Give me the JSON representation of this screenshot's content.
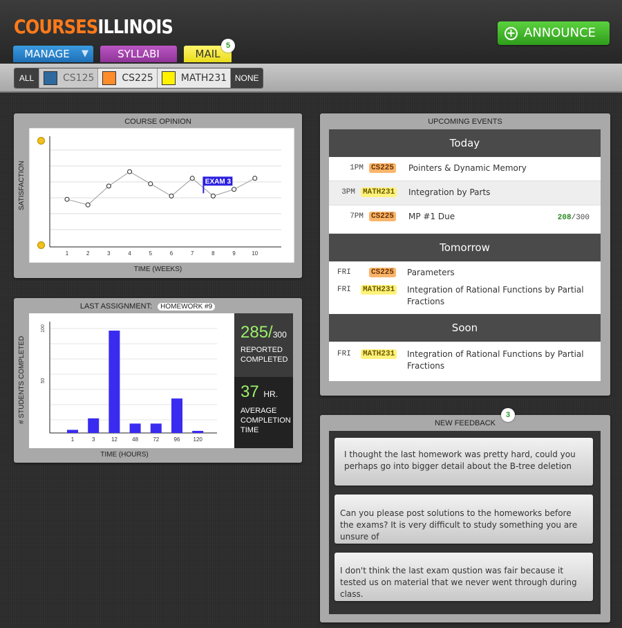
{
  "header": {
    "logo_part1": "COURSES",
    "logo_part2": "ILLINOIS",
    "tabs": {
      "manage": "MANAGE",
      "syllabi": "SYLLABI",
      "mail": "MAIL"
    },
    "mail_count": "5",
    "announce_label": "ANNOUNCE"
  },
  "filter": {
    "all": "ALL",
    "none": "NONE",
    "courses": [
      {
        "label": "CS125",
        "color": "#2e6a9e",
        "enabled": false
      },
      {
        "label": "CS225",
        "color": "#ff8c2a",
        "enabled": true
      },
      {
        "label": "MATH231",
        "color": "#fff200",
        "enabled": true
      }
    ]
  },
  "opinion": {
    "title": "COURSE OPINION",
    "ylabel": "SATISFACTION",
    "xlabel": "TIME (WEEKS)",
    "annotation": "EXAM 3"
  },
  "assignment": {
    "title": "LAST ASSIGNMENT:",
    "name": "HOMEWORK #9",
    "ylabel": "# STUDENTS  COMPLETED",
    "xlabel": "TIME (HOURS)",
    "reported_value": "285/",
    "reported_total": "300",
    "reported_label_1": "REPORTED",
    "reported_label_2": "COMPLETED",
    "avg_value": "37",
    "avg_unit": "HR.",
    "avg_label_1": "AVERAGE",
    "avg_label_2": "COMPLETION",
    "avg_label_3": "TIME"
  },
  "events": {
    "title": "UPCOMING EVENTS",
    "today": "Today",
    "tomorrow": "Tomorrow",
    "soon": "Soon",
    "today_items": [
      {
        "time": "1PM",
        "course": "CS225",
        "text": "Pointers & Dynamic Memory"
      },
      {
        "time": "3PM",
        "course": "MATH231",
        "text": "Integration by Parts"
      },
      {
        "time": "7PM",
        "course": "CS225",
        "text": "MP #1 Due",
        "score": "208",
        "score_total": "/300"
      }
    ],
    "tomorrow_items": [
      {
        "time": "FRI",
        "course": "CS225",
        "text": "Parameters"
      },
      {
        "time": "FRI",
        "course": "MATH231",
        "text": "Integration of Rational Functions by Partial Fractions"
      }
    ],
    "soon_items": [
      {
        "time": "FRI",
        "course": "MATH231",
        "text": "Integration of Rational Functions by Partial Fractions"
      }
    ]
  },
  "feedback": {
    "title": "NEW FEEDBACK",
    "count": "3",
    "items": [
      "I thought the last homework was pretty hard, could you perhaps go into bigger detail about the B-tree deletion",
      "Can you please post solutions to the homeworks before the exams? It is very difficult to study something you are unsure of",
      "I don't think the last exam qustion was fair because it tested us on material that we never went through during class."
    ]
  },
  "chart_data": [
    {
      "type": "line",
      "title": "COURSE OPINION",
      "xlabel": "TIME (WEEKS)",
      "ylabel": "SATISFACTION",
      "x": [
        1,
        2,
        3,
        4,
        5,
        6,
        7,
        8,
        9,
        10
      ],
      "y": [
        0.43,
        0.38,
        0.55,
        0.68,
        0.57,
        0.46,
        0.62,
        0.46,
        0.52,
        0.62
      ],
      "ylim": [
        0,
        1
      ],
      "tick_labels": [
        "1",
        "2",
        "3",
        "4",
        "5",
        "6",
        "7",
        "8",
        "9",
        "10"
      ],
      "annotations": [
        {
          "x": 8,
          "text": "EXAM 3"
        }
      ],
      "grid": true
    },
    {
      "type": "bar",
      "title": "LAST ASSIGNMENT:",
      "xlabel": "TIME (HOURS)",
      "ylabel": "# STUDENTS  COMPLETED",
      "categories": [
        "1",
        "3",
        "12",
        "48",
        "72",
        "96",
        "120"
      ],
      "values": [
        3,
        14,
        98,
        9,
        9,
        33,
        2
      ],
      "ylim": [
        0,
        100
      ],
      "yticks": [
        "50",
        "100"
      ],
      "bar_color": "#3a2bf0",
      "grid": true
    }
  ]
}
